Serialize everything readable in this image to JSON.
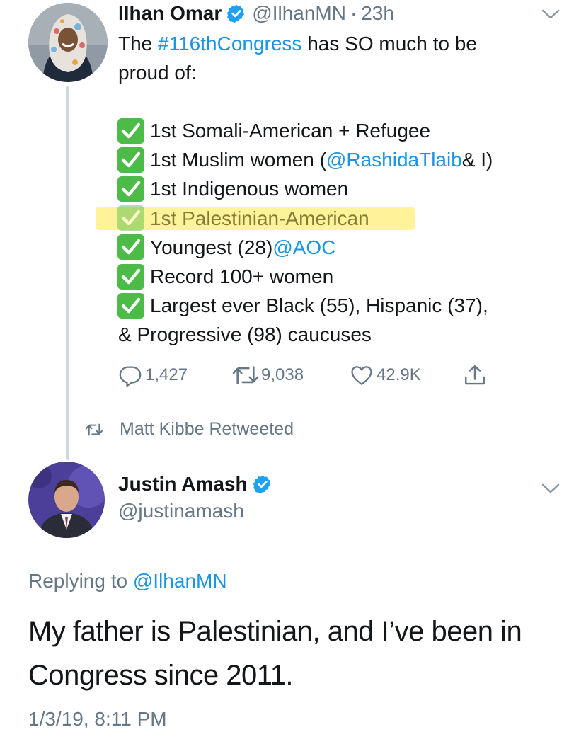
{
  "tweet1": {
    "name": "Ilhan Omar",
    "handle": "@IlhanMN",
    "separator": "·",
    "time": "23h",
    "text_pre": "The ",
    "hashtag": "#116thCongress",
    "text_post": " has SO much to be",
    "text_line2": "proud of:",
    "list": [
      {
        "text": "1st Somali-American + Refugee"
      },
      {
        "text_pre": "1st Muslim women (",
        "mention": "@RashidaTlaib",
        "text_post": " & I)"
      },
      {
        "text": "1st Indigenous women"
      },
      {
        "text": "1st Palestinian-American",
        "highlighted": true
      },
      {
        "text_pre": "Youngest (28) ",
        "mention": "@AOC"
      },
      {
        "text": "Record 100+ women"
      },
      {
        "text": "Largest ever Black (55), Hispanic (37),"
      }
    ],
    "list_continuation": "& Progressive (98) caucuses",
    "replies": "1,427",
    "retweets": "9,038",
    "likes": "42.9K"
  },
  "retweet_context": "Matt Kibbe Retweeted",
  "tweet2": {
    "name": "Justin Amash",
    "handle": "@justinamash",
    "replying_label": "Replying to ",
    "replying_to": "@IlhanMN",
    "text_line1": "My father is Palestinian, and I’ve been in",
    "text_line2": "Congress since 2011.",
    "timestamp": "1/3/19, 8:11 PM"
  },
  "colors": {
    "link": "#1b95e0",
    "secondary": "#657786",
    "verified": "#1da1f2",
    "check_green": "#4cbb47",
    "highlight": "#ffec5a"
  },
  "icons": [
    "verified-badge-icon",
    "chevron-down-icon",
    "check-box-icon",
    "reply-icon",
    "retweet-icon",
    "like-icon",
    "share-icon"
  ]
}
